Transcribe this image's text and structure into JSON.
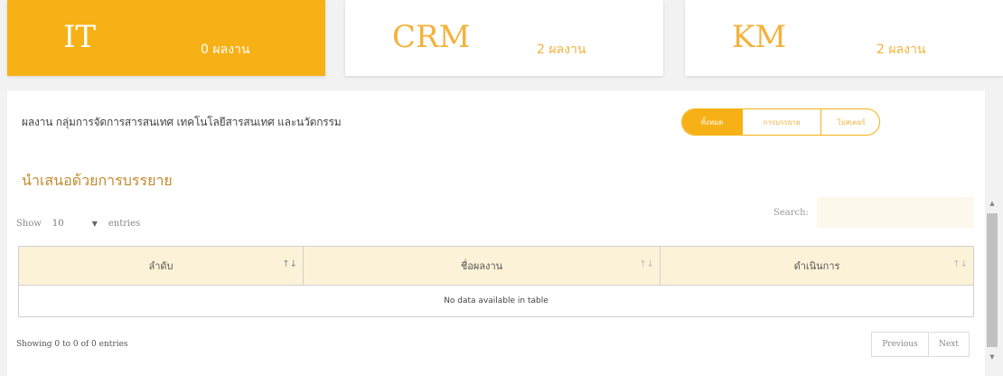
{
  "cards": [
    {
      "title": "IT",
      "count": "0 ผลงาน",
      "active": true
    },
    {
      "title": "CRM",
      "count": "2 ผลงาน",
      "active": false
    },
    {
      "title": "KM",
      "count": "2 ผลงาน",
      "active": false
    }
  ],
  "panel": {
    "subtitle": "ผลงาน กลุ่มการจัดการสารสนเทศ เทคโนโลยีสารสนเทศ และนวัตกรรม",
    "view_toggle": {
      "options": [
        "ทั้งหมด",
        "การบรรยาย",
        "โปสเตอร์"
      ],
      "selected": "ทั้งหมด"
    },
    "section_title": "นำเสนอด้วยการบรรยาย"
  },
  "datatable": {
    "show_label": "Show",
    "page_size": "10",
    "entries_label": "entries",
    "search_label": "Search:",
    "search_value": "",
    "columns": [
      "ลำดับ",
      "ชื่อผลงาน",
      "ดำเนินการ"
    ],
    "sort_icon": "sort-arrows-icon",
    "empty_message": "No data available in table",
    "info": "Showing 0 to 0 of 0 entries",
    "pagination": {
      "previous": "Previous",
      "next": "Next"
    }
  },
  "colors": {
    "accent": "#f7b116",
    "accent_text": "#f3b23a",
    "header_bg": "#fcf2d8",
    "section_title": "#c38a2c"
  }
}
